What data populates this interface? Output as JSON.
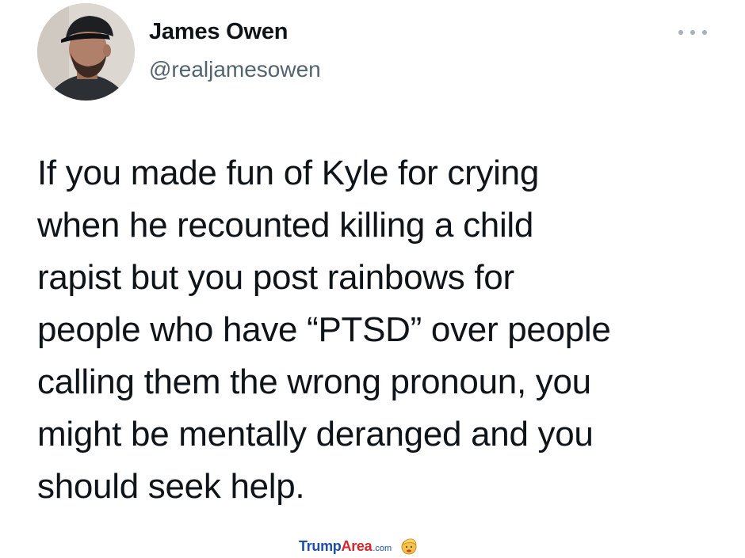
{
  "author": {
    "name": "James Owen",
    "handle": "@realjamesowen",
    "avatar_icon": "profile-photo"
  },
  "menu": {
    "icon": "more-horizontal-icon"
  },
  "tweet": {
    "lines": [
      "If you made fun of Kyle for crying",
      "when he recounted killing a child",
      "rapist but you post rainbows for",
      "people who have “PTSD” over people",
      "calling them the wrong pronoun, you",
      "might be mentally deranged and you",
      "should seek help."
    ]
  },
  "watermark": {
    "part1": "Trump",
    "part2": "Area",
    "part3": ".com",
    "logo_icon": "cartoon-face-logo"
  },
  "colors": {
    "text": "#0f1419",
    "secondary": "#536471",
    "watermark_blue": "#1f4fa8",
    "watermark_red": "#d4272d"
  }
}
